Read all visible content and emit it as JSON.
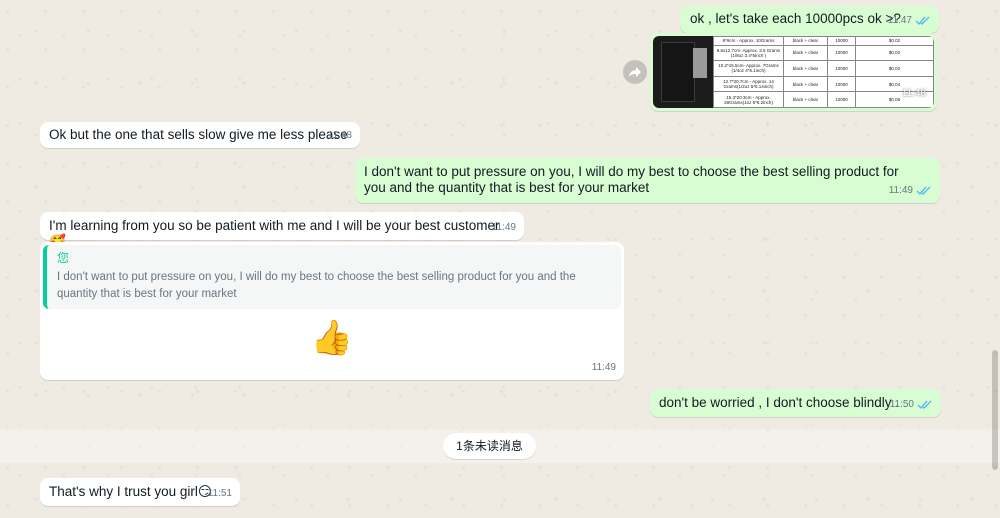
{
  "colors": {
    "background": "#efeae2",
    "incoming_bubble": "#ffffff",
    "outgoing_bubble": "#d9fdd3",
    "read_ticks": "#53bdeb",
    "quote_accent": "#06cf9c",
    "timestamp": "#667781"
  },
  "messages": [
    {
      "direction": "outgoing",
      "type": "text",
      "text": "ok , let's take each 10000pcs ok >?",
      "time": "11:47",
      "status": "read"
    },
    {
      "direction": "outgoing",
      "type": "image",
      "time": "11:48",
      "status": "read",
      "image": {
        "rows": [
          {
            "desc": "8*9cm - Approx. 10Grams",
            "color": "black + clear",
            "qty": "10000",
            "price": "$0.02"
          },
          {
            "desc": "8.6x12.7cm- Approx. 3.5 Grams (1/8oz 3.4*5inch )",
            "color": "black + clear",
            "qty": "10000",
            "price": "$0.02"
          },
          {
            "desc": "10.2*15.5cm- Approx. 7Grams (1/4oz 4*6.1inch)",
            "color": "black + clear",
            "qty": "10000",
            "price": "$0.02"
          },
          {
            "desc": "12.7*20.7cm - Approx. 14 Grams(1/2oz 5*8.14inch)",
            "color": "black + clear",
            "qty": "10000",
            "price": "$0.04"
          },
          {
            "desc": "15.3*20.3cm - Approx. 28Grams(1oz 6*8.2inch)",
            "color": "black + clear",
            "qty": "10000",
            "price": "$0.06"
          }
        ]
      }
    },
    {
      "direction": "incoming",
      "type": "text",
      "text": "Ok but the one that sells slow give me less please",
      "time": "11:48"
    },
    {
      "direction": "outgoing",
      "type": "text",
      "text": "I don't want to put pressure on you, I will do my best to choose the best selling product for you and the quantity that is best for your market",
      "time": "11:49",
      "status": "read"
    },
    {
      "direction": "incoming",
      "type": "text",
      "text": "I'm learning from you so be patient with me and I will be your best customer🥰",
      "time": "11:49"
    },
    {
      "direction": "incoming",
      "type": "reply",
      "quote_author": "您",
      "quote_text": "I don't want to put pressure on you, I will do my best to choose the best selling product for you and the quantity that is best for your market",
      "text": "👍",
      "time": "11:49"
    },
    {
      "direction": "outgoing",
      "type": "text",
      "text": "don't be worried , I don't choose blindly .",
      "time": "11:50",
      "status": "read"
    },
    {
      "direction": "incoming",
      "type": "text",
      "text": "That's why I trust you girl😏",
      "time": "11:51"
    }
  ],
  "unread_divider": "1条未读消息",
  "icons": {
    "forward": "forward-icon",
    "read": "double-check-icon"
  }
}
